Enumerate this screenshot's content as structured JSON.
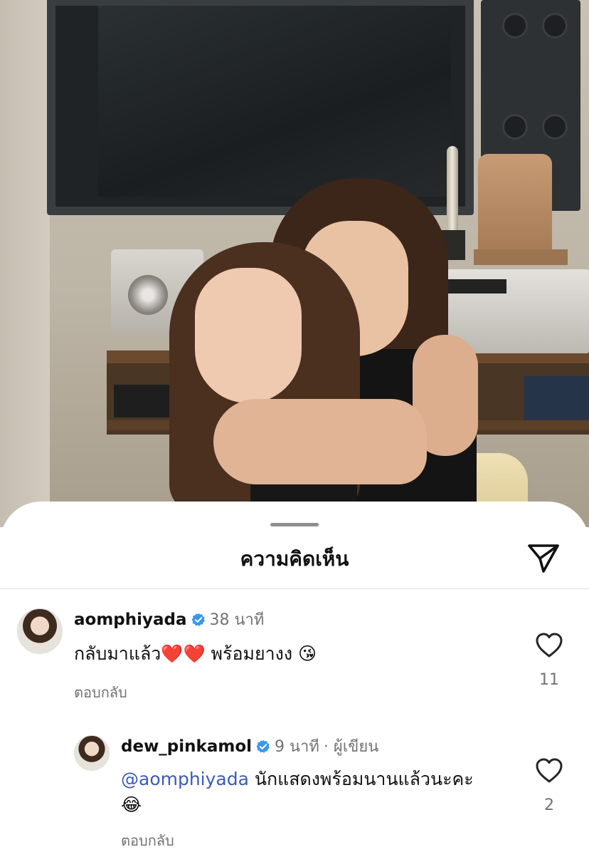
{
  "sheet": {
    "title": "ความคิดเห็น",
    "share_icon": "paper-plane-icon"
  },
  "comments": [
    {
      "username": "aomphiyada",
      "verified": true,
      "time": "38 นาที",
      "text_main": "กลับมาแล้ว",
      "emoji_hearts": "❤️❤️",
      "text_after": " พร้อมยางง ",
      "emoji_end": "😘",
      "reply_label": "ตอบกลับ",
      "like_count": "11"
    },
    {
      "username": "dew_pinkamol",
      "verified": true,
      "time": "9 นาที",
      "author_tag": "· ผู้เขียน",
      "mention": "@aomphiyada",
      "text": " นักแสดงพร้อมนานแล้วนะคะ",
      "emoji_end": "😂",
      "reply_label": "ตอบกลับ",
      "like_count": "2"
    }
  ],
  "colors": {
    "mention": "#3b5bb8",
    "verified": "#3897f0",
    "muted": "#737373"
  }
}
